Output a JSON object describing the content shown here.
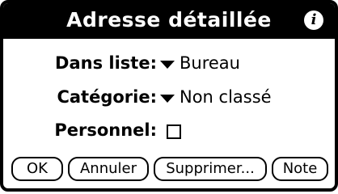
{
  "dialog": {
    "title": "Adresse détaillée",
    "info_icon": "i"
  },
  "fields": {
    "list_label": "Dans liste:",
    "list_value": "Bureau",
    "category_label": "Catégorie:",
    "category_value": "Non classé",
    "private_label": "Personnel:",
    "private_checked": false
  },
  "buttons": {
    "ok": "OK",
    "cancel": "Annuler",
    "delete": "Supprimer...",
    "note": "Note"
  },
  "icons": {
    "info": "info-icon",
    "dropdown": "triangle-down-icon",
    "checkbox": "checkbox-empty"
  }
}
